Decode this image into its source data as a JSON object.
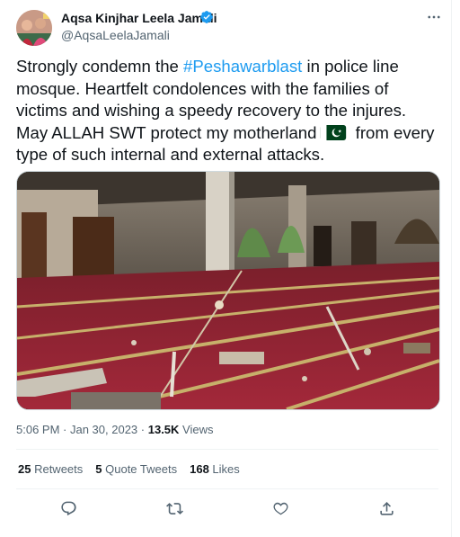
{
  "author": {
    "name": "Aqsa Kinjhar Leela Jamali",
    "handle": "@AqsaLeelaJamali"
  },
  "tweet": {
    "text_before_hashtag": "Strongly condemn the ",
    "hashtag": "#Peshawarblast",
    "text_after_hashtag": " in police line mosque. Heartfelt condolences with the families of victims and wishing a speedy recovery to the injures. May ALLAH SWT protect my motherland",
    "flag_emoji_name": "pakistan-flag",
    "text_after_flag": " from every type of such internal and external attacks."
  },
  "meta": {
    "time": "5:06 PM",
    "separator": " · ",
    "date": "Jan 30, 2023",
    "views_count": "13.5K",
    "views_label": " Views"
  },
  "stats": {
    "retweets_count": "25",
    "retweets_label": " Retweets",
    "quotes_count": "5",
    "quotes_label": " Quote Tweets",
    "likes_count": "168",
    "likes_label": " Likes"
  },
  "colors": {
    "link": "#1d9bf0",
    "secondary_text": "#536471",
    "primary_text": "#0f1419",
    "verified_badge": "#1d9bf0",
    "flag_green": "#01411c"
  },
  "icons": [
    "verified-badge-icon",
    "more-options-icon",
    "reply-icon",
    "retweet-icon",
    "like-icon",
    "share-icon"
  ]
}
